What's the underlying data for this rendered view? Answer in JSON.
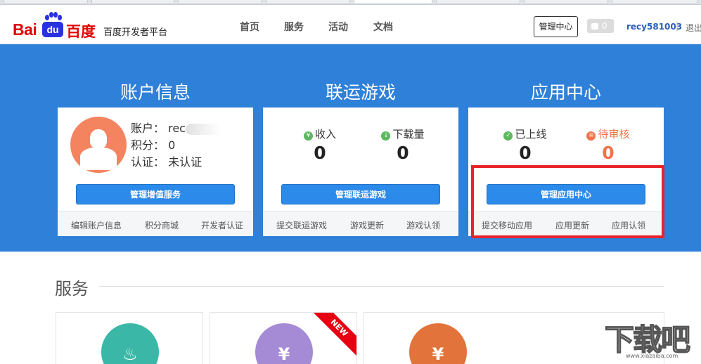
{
  "header": {
    "logo_bai": "Bai",
    "logo_du": "du",
    "logo_baidu_cn": "百度",
    "platform_title": "百度开发者平台",
    "nav": [
      "首页",
      "服务",
      "活动",
      "文档"
    ],
    "manage_center": "管理中心",
    "message_count": "0",
    "username": "recy581003",
    "separator": "|",
    "logout": "退出"
  },
  "columns": {
    "account": {
      "title": "账户信息",
      "account_label": "账户：",
      "account_value": "rec",
      "points_label": "积分：",
      "points_value": "0",
      "verify_label": "认证：",
      "verify_value": "未认证",
      "button": "管理增值服务",
      "links": [
        "编辑账户信息",
        "积分商城",
        "开发者认证"
      ]
    },
    "games": {
      "title": "联运游戏",
      "stat1_label": "收入",
      "stat1_value": "0",
      "stat2_label": "下载量",
      "stat2_value": "0",
      "button": "管理联运游戏",
      "links": [
        "提交联运游戏",
        "游戏更新",
        "游戏认领"
      ]
    },
    "apps": {
      "title": "应用中心",
      "stat1_label": "已上线",
      "stat1_value": "0",
      "stat2_label": "待审核",
      "stat2_value": "0",
      "button": "管理应用中心",
      "links": [
        "提交移动应用",
        "应用更新",
        "应用认领"
      ]
    }
  },
  "services": {
    "title": "服务",
    "new_badge": "NEW",
    "cards": [
      {
        "icon": "flame-icon",
        "color": "#3bb7a7"
      },
      {
        "icon": "money-bag-icon",
        "color": "#a58ad6"
      },
      {
        "icon": "yen-cycle-icon",
        "color": "#e2733a"
      }
    ]
  },
  "colors": {
    "banner": "#2f80d8",
    "button": "#2b8aea",
    "highlight": "#e8232b",
    "pending": "#f0734a",
    "online": "#5cb85c"
  },
  "watermark": {
    "text": "下载吧",
    "url": "www.xiazaiba.com"
  }
}
